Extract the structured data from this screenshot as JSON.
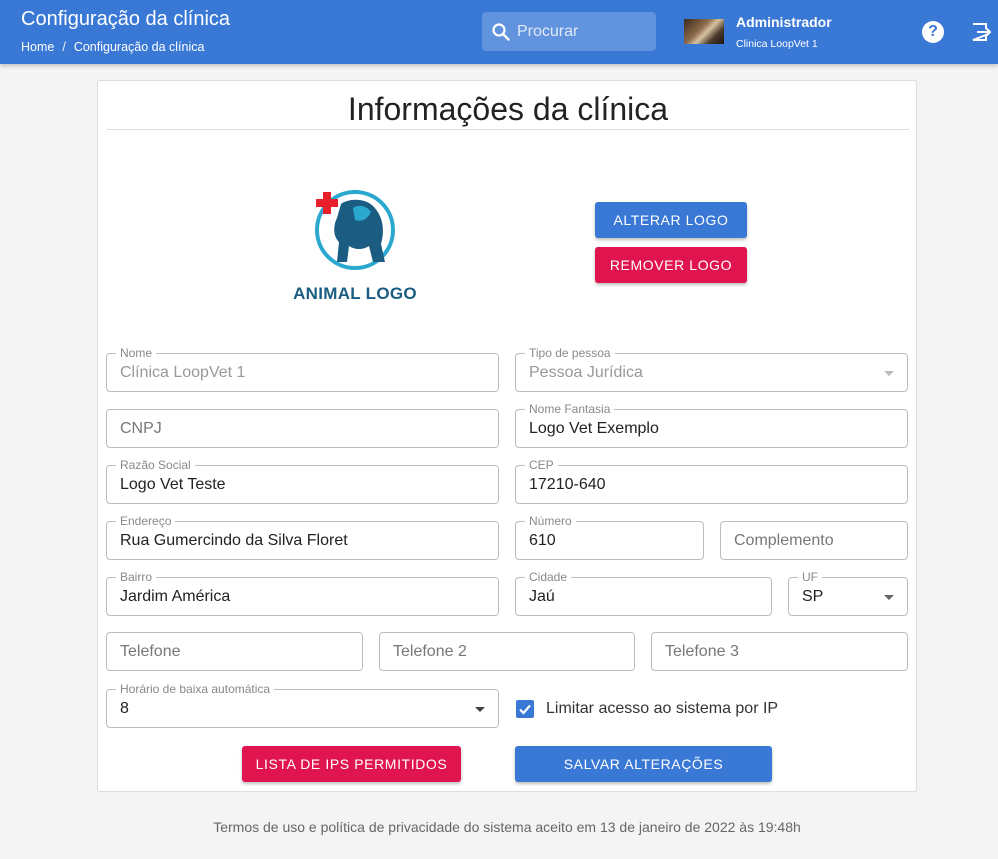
{
  "header": {
    "title": "Configuração da clínica",
    "breadcrumb": [
      "Home",
      "Configuração da clínica"
    ],
    "breadcrumb_sep": "/",
    "search_placeholder": "Procurar",
    "user_name": "Administrador",
    "user_clinic": "Clinica LoopVet 1",
    "help_icon": "help-icon",
    "logout_icon": "logout-icon"
  },
  "card": {
    "title": "Informações da clínica",
    "logo_text": "ANIMAL LOGO",
    "change_logo_label": "ALTERAR LOGO",
    "remove_logo_label": "REMOVER LOGO"
  },
  "form": {
    "nome": {
      "label": "Nome",
      "value": "Clínica LoopVet 1"
    },
    "tipo_pessoa": {
      "label": "Tipo de pessoa",
      "value": "Pessoa Jurídica"
    },
    "cnpj": {
      "placeholder": "CNPJ"
    },
    "nome_fantasia": {
      "label": "Nome Fantasia",
      "value": "Logo Vet Exemplo"
    },
    "razao_social": {
      "label": "Razão Social",
      "value": "Logo Vet Teste"
    },
    "cep": {
      "label": "CEP",
      "value": "17210-640"
    },
    "endereco": {
      "label": "Endereço",
      "value": "Rua Gumercindo da Silva Floret"
    },
    "numero": {
      "label": "Número",
      "value": "610"
    },
    "complemento": {
      "placeholder": "Complemento"
    },
    "bairro": {
      "label": "Bairro",
      "value": "Jardim América"
    },
    "cidade": {
      "label": "Cidade",
      "value": "Jaú"
    },
    "uf": {
      "label": "UF",
      "value": "SP"
    },
    "telefone": {
      "placeholder": "Telefone"
    },
    "telefone2": {
      "placeholder": "Telefone 2"
    },
    "telefone3": {
      "placeholder": "Telefone 3"
    },
    "horario": {
      "label": "Horário de baixa automática",
      "value": "8"
    },
    "limitar_ip": {
      "label": "Limitar acesso ao sistema por IP",
      "checked": true
    },
    "lista_ips_label": "LISTA DE IPS PERMITIDOS",
    "salvar_label": "SALVAR ALTERAÇÕES"
  },
  "footer": {
    "text": "Termos de uso e política de privacidade do sistema aceito em 13 de janeiro de 2022 às 19:48h"
  },
  "colors": {
    "primary": "#3a78d6",
    "danger": "#e0144f",
    "logo_teal": "#2aa8d0",
    "logo_navy": "#1b5c82",
    "logo_red": "#e8202a"
  }
}
